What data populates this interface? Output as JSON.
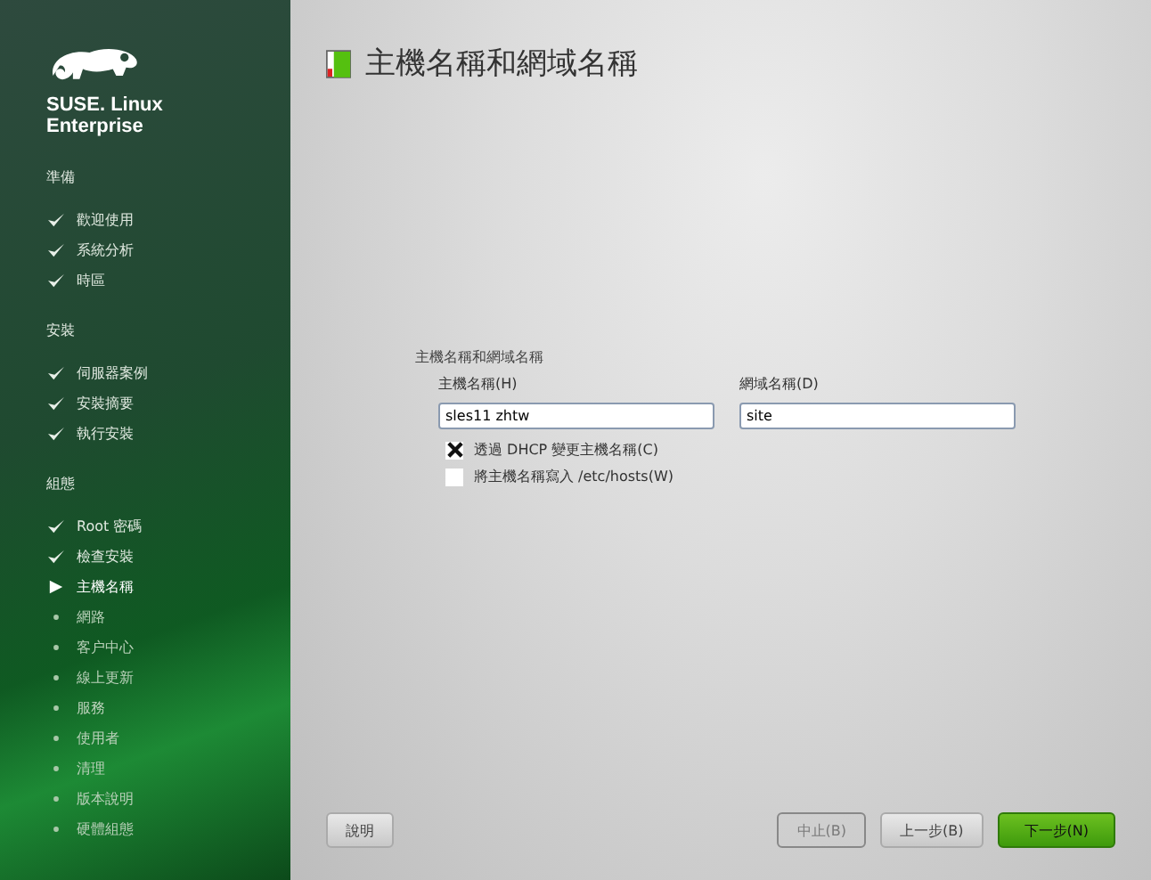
{
  "sidebar": {
    "brand": "SUSE. Linux Enterprise",
    "sections": [
      {
        "title": "準備",
        "items": [
          {
            "label": "歡迎使用",
            "done": true,
            "selected": false
          },
          {
            "label": "系統分析",
            "done": true,
            "selected": false
          },
          {
            "label": "時區",
            "done": true,
            "selected": false
          }
        ]
      },
      {
        "title": "安裝",
        "items": [
          {
            "label": "伺服器案例",
            "done": true,
            "selected": false
          },
          {
            "label": "安裝摘要",
            "done": true,
            "selected": false
          },
          {
            "label": "執行安裝",
            "done": true,
            "selected": false
          }
        ]
      },
      {
        "title": "組態",
        "items": [
          {
            "label": "Root 密碼",
            "done": true,
            "selected": false
          },
          {
            "label": "檢查安裝",
            "done": true,
            "selected": false
          },
          {
            "label": "主機名稱",
            "done": false,
            "selected": true
          },
          {
            "label": "網路",
            "done": false,
            "selected": false
          },
          {
            "label": "客户中心",
            "done": false,
            "selected": false
          },
          {
            "label": "線上更新",
            "done": false,
            "selected": false
          },
          {
            "label": "服務",
            "done": false,
            "selected": false
          },
          {
            "label": "使用者",
            "done": false,
            "selected": false
          },
          {
            "label": "清理",
            "done": false,
            "selected": false
          },
          {
            "label": "版本說明",
            "done": false,
            "selected": false
          },
          {
            "label": "硬體組態",
            "done": false,
            "selected": false
          }
        ]
      }
    ]
  },
  "page": {
    "title": "主機名稱和網域名稱"
  },
  "form": {
    "group_label": "主機名稱和網域名稱",
    "fields": [
      {
        "label": "主機名稱(H)",
        "value": "sles11 zhtw"
      },
      {
        "label": "網域名稱(D)",
        "value": "site"
      }
    ],
    "checkboxes": [
      {
        "label": "透過 DHCP 變更主機名稱(C)",
        "checked": true
      },
      {
        "label": "將主機名稱寫入 /etc/hosts(W)",
        "checked": false
      }
    ]
  },
  "help_button": "說明",
  "buttons": [
    {
      "label": "中止(B)",
      "disabled": true,
      "default": false
    },
    {
      "label": "上一步(B)",
      "disabled": false,
      "default": false
    },
    {
      "label": "下一步(N)",
      "disabled": false,
      "default": true
    }
  ]
}
